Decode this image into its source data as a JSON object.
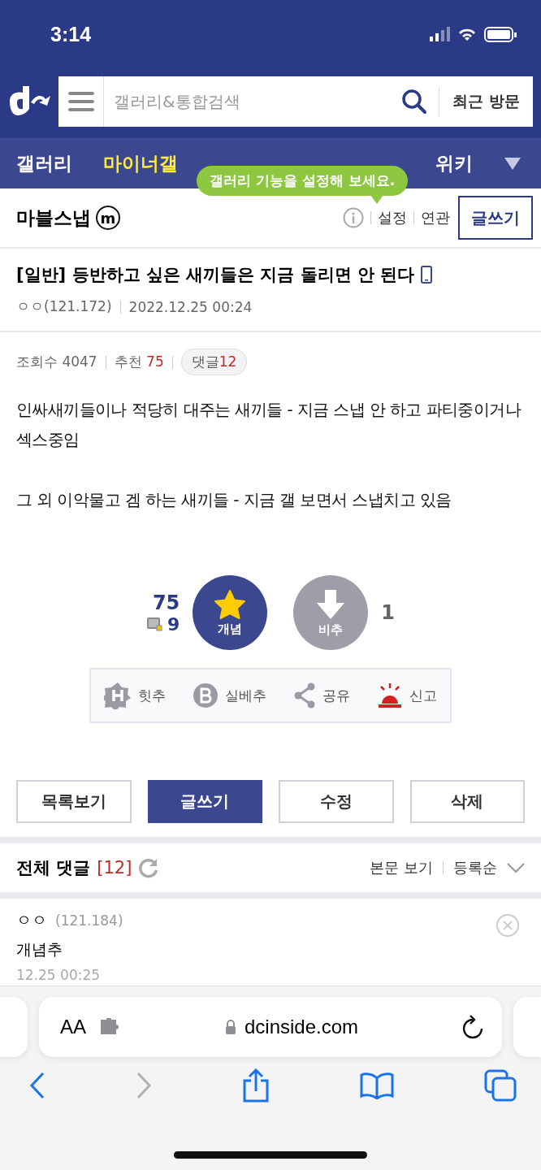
{
  "status_bar": {
    "time": "3:14"
  },
  "header": {
    "search_placeholder": "갤러리&통합검색",
    "recent_button": "최근 방문"
  },
  "nav": {
    "items": [
      {
        "label": "갤러리",
        "selected": false
      },
      {
        "label": "마이너갤",
        "selected": true
      },
      {
        "label": "위키",
        "selected": false
      }
    ],
    "tooltip": "갤러리 기능을 설정해 보세요."
  },
  "gallery": {
    "name": "마블스냅",
    "badge": "m",
    "links": [
      "설정",
      "연관"
    ],
    "write_button": "글쓰기"
  },
  "post": {
    "title": "[일반] 등반하고 싶은 새끼들은 지금 돌리면 안 된다",
    "author": "ㅇㅇ(121.172)",
    "date": "2022.12.25 00:24",
    "stats": [
      {
        "kind": "plain",
        "label": "조회수",
        "value": "4047"
      },
      {
        "kind": "red",
        "label": "추천",
        "value": "75"
      },
      {
        "kind": "pill",
        "label": "댓글",
        "value": "12"
      }
    ],
    "paragraphs": [
      "인싸새끼들이나 적당히 대주는 새끼들 - 지금 스냅 안 하고 파티중이거나 섹스중임",
      "그 외 이악물고 겜 하는 새끼들 - 지금 갤 보면서 스냅치고 있음"
    ]
  },
  "votes": {
    "up_count": "75",
    "mobile_count": "9",
    "up_label": "개념",
    "down_label": "비추",
    "down_count": "1"
  },
  "actions": [
    {
      "kind": "hit",
      "label": "힛추"
    },
    {
      "kind": "best",
      "label": "실베추"
    },
    {
      "kind": "share",
      "label": "공유"
    },
    {
      "kind": "report",
      "label": "신고"
    }
  ],
  "buttons": [
    {
      "label": "목록보기",
      "selected": false
    },
    {
      "label": "글쓰기",
      "selected": true
    },
    {
      "label": "수정",
      "selected": false
    },
    {
      "label": "삭제",
      "selected": false
    }
  ],
  "comments": {
    "title": "전체 댓글",
    "count": "[12]",
    "view_link": "본문 보기",
    "sort": "등록순",
    "items": [
      {
        "author": "ㅇㅇ",
        "ip": "(121.184)",
        "text": "개념추",
        "time": "12.25 00:25"
      }
    ]
  },
  "browser": {
    "text_size": "AA",
    "url": "dcinside.com"
  }
}
